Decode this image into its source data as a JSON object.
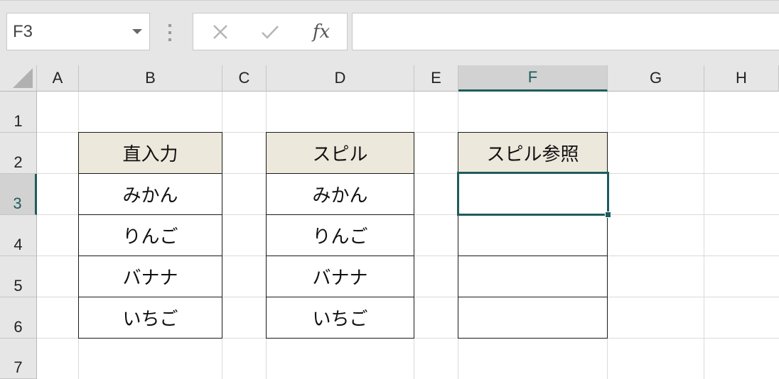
{
  "name_box": {
    "value": "F3"
  },
  "formula_bar": {
    "fx_label": "fx",
    "value": ""
  },
  "columns": [
    "A",
    "B",
    "C",
    "D",
    "E",
    "F",
    "G",
    "H"
  ],
  "rows": [
    "1",
    "2",
    "3",
    "4",
    "5",
    "6",
    "7"
  ],
  "selected_cell": {
    "column": "F",
    "row": "3"
  },
  "tables": {
    "direct": {
      "header": "直入力",
      "items": [
        "みかん",
        "りんご",
        "バナナ",
        "いちご"
      ]
    },
    "spill": {
      "header": "スピル",
      "items": [
        "みかん",
        "りんご",
        "バナナ",
        "いちご"
      ]
    },
    "spill_ref": {
      "header": "スピル参照",
      "items": [
        "",
        "",
        "",
        ""
      ]
    }
  },
  "colors": {
    "header_fill": "#ede8dc",
    "selection": "#1e5c5c"
  }
}
